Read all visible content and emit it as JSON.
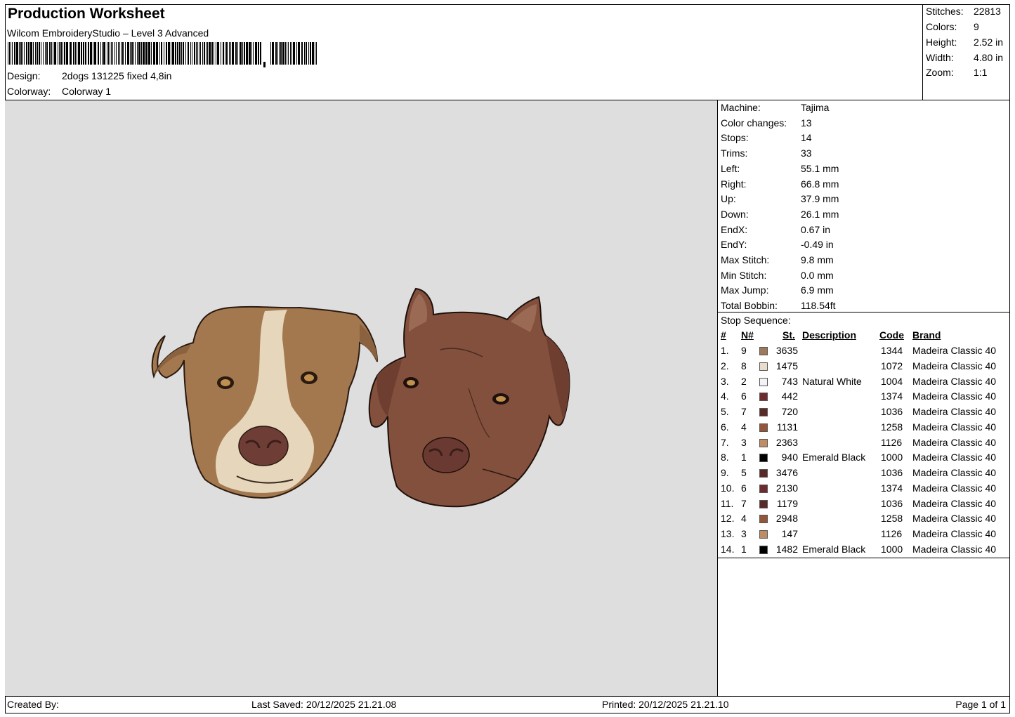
{
  "header": {
    "title": "Production Worksheet",
    "software": "Wilcom EmbroideryStudio – Level 3 Advanced",
    "design_label": "Design:",
    "design_value": "2dogs 131225 fixed 4,8in",
    "colorway_label": "Colorway:",
    "colorway_value": "Colorway 1"
  },
  "stats": [
    {
      "label": "Stitches:",
      "value": "22813"
    },
    {
      "label": "Colors:",
      "value": "9"
    },
    {
      "label": "Height:",
      "value": "2.52 in"
    },
    {
      "label": "Width:",
      "value": "4.80 in"
    },
    {
      "label": "Zoom:",
      "value": "1:1"
    }
  ],
  "machine_info": [
    {
      "label": "Machine:",
      "value": "Tajima"
    },
    {
      "label": "Color changes:",
      "value": "13"
    },
    {
      "label": "Stops:",
      "value": "14"
    },
    {
      "label": "Trims:",
      "value": "33"
    },
    {
      "label": "Left:",
      "value": "55.1 mm"
    },
    {
      "label": "Right:",
      "value": "66.8 mm"
    },
    {
      "label": "Up:",
      "value": "37.9 mm"
    },
    {
      "label": "Down:",
      "value": "26.1 mm"
    },
    {
      "label": "EndX:",
      "value": "0.67 in"
    },
    {
      "label": "EndY:",
      "value": "-0.49 in"
    },
    {
      "label": "Max Stitch:",
      "value": "9.8 mm"
    },
    {
      "label": "Min Stitch:",
      "value": "0.0 mm"
    },
    {
      "label": "Max Jump:",
      "value": "6.9 mm"
    },
    {
      "label": "Total Bobbin:",
      "value": "118.54ft"
    }
  ],
  "stop_sequence": {
    "title": "Stop Sequence:",
    "columns": {
      "idx": "#",
      "n": "N#",
      "st": "St.",
      "desc": "Description",
      "code": "Code",
      "brand": "Brand"
    },
    "rows": [
      {
        "idx": "1.",
        "n": "9",
        "color": "#a0785a",
        "st": "3635",
        "desc": "",
        "code": "1344",
        "brand": "Madeira Classic 40"
      },
      {
        "idx": "2.",
        "n": "8",
        "color": "#e8dccb",
        "st": "1475",
        "desc": "",
        "code": "1072",
        "brand": "Madeira Classic 40"
      },
      {
        "idx": "3.",
        "n": "2",
        "color": "#f4f2f6",
        "st": "743",
        "desc": "Natural White",
        "code": "1004",
        "brand": "Madeira Classic 40"
      },
      {
        "idx": "4.",
        "n": "6",
        "color": "#6e2a2e",
        "st": "442",
        "desc": "",
        "code": "1374",
        "brand": "Madeira Classic 40"
      },
      {
        "idx": "5.",
        "n": "7",
        "color": "#5a2a28",
        "st": "720",
        "desc": "",
        "code": "1036",
        "brand": "Madeira Classic 40"
      },
      {
        "idx": "6.",
        "n": "4",
        "color": "#955538",
        "st": "1131",
        "desc": "",
        "code": "1258",
        "brand": "Madeira Classic 40"
      },
      {
        "idx": "7.",
        "n": "3",
        "color": "#c08c64",
        "st": "2363",
        "desc": "",
        "code": "1126",
        "brand": "Madeira Classic 40"
      },
      {
        "idx": "8.",
        "n": "1",
        "color": "#000000",
        "st": "940",
        "desc": "Emerald Black",
        "code": "1000",
        "brand": "Madeira Classic 40"
      },
      {
        "idx": "9.",
        "n": "5",
        "color": "#5a2a28",
        "st": "3476",
        "desc": "",
        "code": "1036",
        "brand": "Madeira Classic 40"
      },
      {
        "idx": "10.",
        "n": "6",
        "color": "#6e2a2e",
        "st": "2130",
        "desc": "",
        "code": "1374",
        "brand": "Madeira Classic 40"
      },
      {
        "idx": "11.",
        "n": "7",
        "color": "#5a2a28",
        "st": "1179",
        "desc": "",
        "code": "1036",
        "brand": "Madeira Classic 40"
      },
      {
        "idx": "12.",
        "n": "4",
        "color": "#955538",
        "st": "2948",
        "desc": "",
        "code": "1258",
        "brand": "Madeira Classic 40"
      },
      {
        "idx": "13.",
        "n": "3",
        "color": "#c08c64",
        "st": "147",
        "desc": "",
        "code": "1126",
        "brand": "Madeira Classic 40"
      },
      {
        "idx": "14.",
        "n": "1",
        "color": "#000000",
        "st": "1482",
        "desc": "Emerald Black",
        "code": "1000",
        "brand": "Madeira Classic 40"
      }
    ]
  },
  "footer": {
    "created_by": "Created By:",
    "last_saved": "Last Saved: 20/12/2025 21.21.08",
    "printed": "Printed: 20/12/2025 21.21.10",
    "page": "Page 1 of 1"
  },
  "preview": {
    "background": "#dedede",
    "subject": "two-dog-embroidery-design"
  }
}
